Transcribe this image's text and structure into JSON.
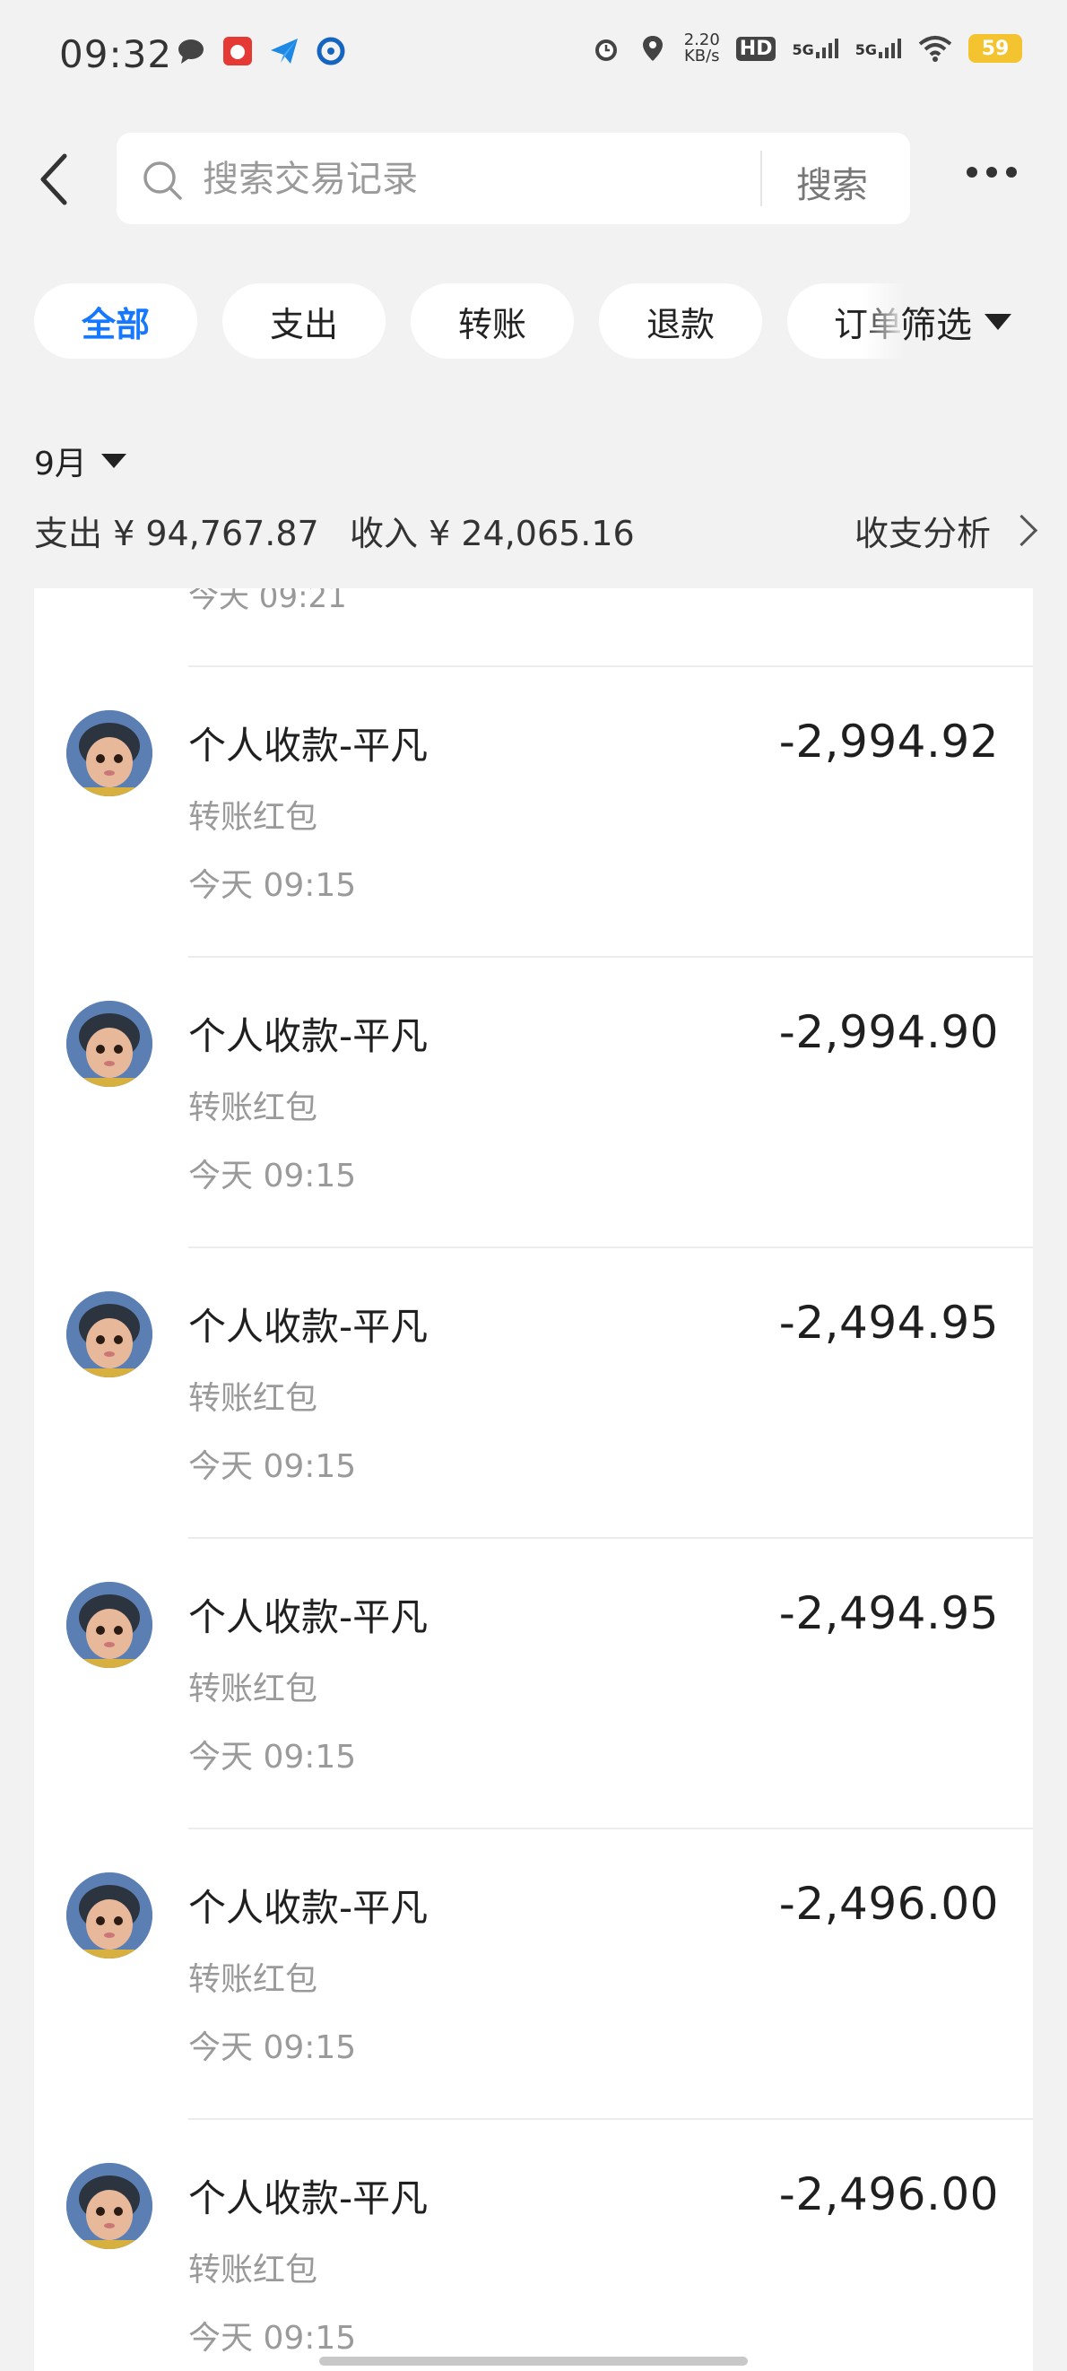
{
  "status_bar": {
    "time": "09:32",
    "net_speed": "2.20",
    "net_unit": "KB/s",
    "hd_label": "HD",
    "sim1_label": "5G",
    "sim2_label": "5G",
    "battery": "59"
  },
  "search": {
    "placeholder": "搜索交易记录",
    "button_label": "搜索"
  },
  "filters": {
    "chips": [
      "全部",
      "支出",
      "转账",
      "退款",
      "订单"
    ],
    "active_index": 0,
    "filter_label": "筛选"
  },
  "period": {
    "month": "9月",
    "expense": "支出 ¥ 94,767.87",
    "income": "收入 ¥ 24,065.16",
    "analysis": "收支分析"
  },
  "partial_prev_time": "今天 09:21",
  "transactions": [
    {
      "title": "个人收款-平凡",
      "category": "转账红包",
      "time": "今天 09:15",
      "amount": "-2,994.92"
    },
    {
      "title": "个人收款-平凡",
      "category": "转账红包",
      "time": "今天 09:15",
      "amount": "-2,994.90"
    },
    {
      "title": "个人收款-平凡",
      "category": "转账红包",
      "time": "今天 09:15",
      "amount": "-2,494.95"
    },
    {
      "title": "个人收款-平凡",
      "category": "转账红包",
      "time": "今天 09:15",
      "amount": "-2,494.95"
    },
    {
      "title": "个人收款-平凡",
      "category": "转账红包",
      "time": "今天 09:15",
      "amount": "-2,496.00"
    },
    {
      "title": "个人收款-平凡",
      "category": "转账红包",
      "time": "今天 09:15",
      "amount": "-2,496.00"
    }
  ],
  "colors": {
    "accent": "#1677ff",
    "background": "#f2f2f2",
    "battery": "#f4c430"
  }
}
